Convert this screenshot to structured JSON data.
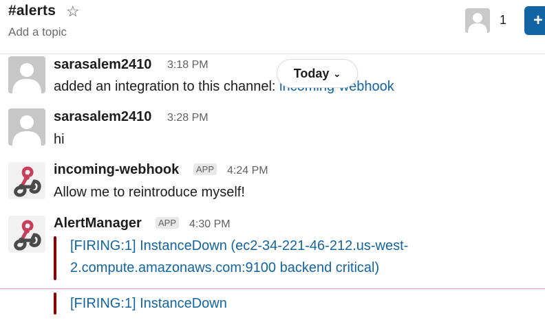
{
  "channel": {
    "name": "#alerts",
    "star_icon": "star-outline-icon",
    "topic_placeholder": "Add a topic",
    "member_count": "1",
    "add_button_label": "+"
  },
  "date_divider": {
    "label": "Today",
    "icon": "chevron-down-icon"
  },
  "messages": [
    {
      "user": "sarasalem2410",
      "time": "3:18 PM",
      "text_prefix": "added an integration to this channel: ",
      "text_link": "incoming-webhook",
      "avatar": "default-user-avatar"
    },
    {
      "user": "sarasalem2410",
      "time": "3:28 PM",
      "text": "hi",
      "avatar": "default-user-avatar"
    },
    {
      "user": "incoming-webhook",
      "badge": "APP",
      "time": "4:24 PM",
      "text": "Allow me to reintroduce myself!",
      "avatar": "webhook-icon"
    },
    {
      "user": "AlertManager",
      "badge": "APP",
      "time": "4:30 PM",
      "avatar": "webhook-icon",
      "attachments": [
        {
          "title_line1": "[FIRING:1] InstanceDown (ec2-34-221-46-212.us-west-",
          "title_line2": "2.compute.amazonaws.com:9100 backend critical)"
        },
        {
          "title_line1": "[FIRING:1] InstanceDown"
        }
      ]
    }
  ],
  "colors": {
    "link": "#1264a3",
    "attachment_bar": "#8b0000",
    "primary_button": "#1264a3",
    "new_divider": "#e8a2b5"
  }
}
